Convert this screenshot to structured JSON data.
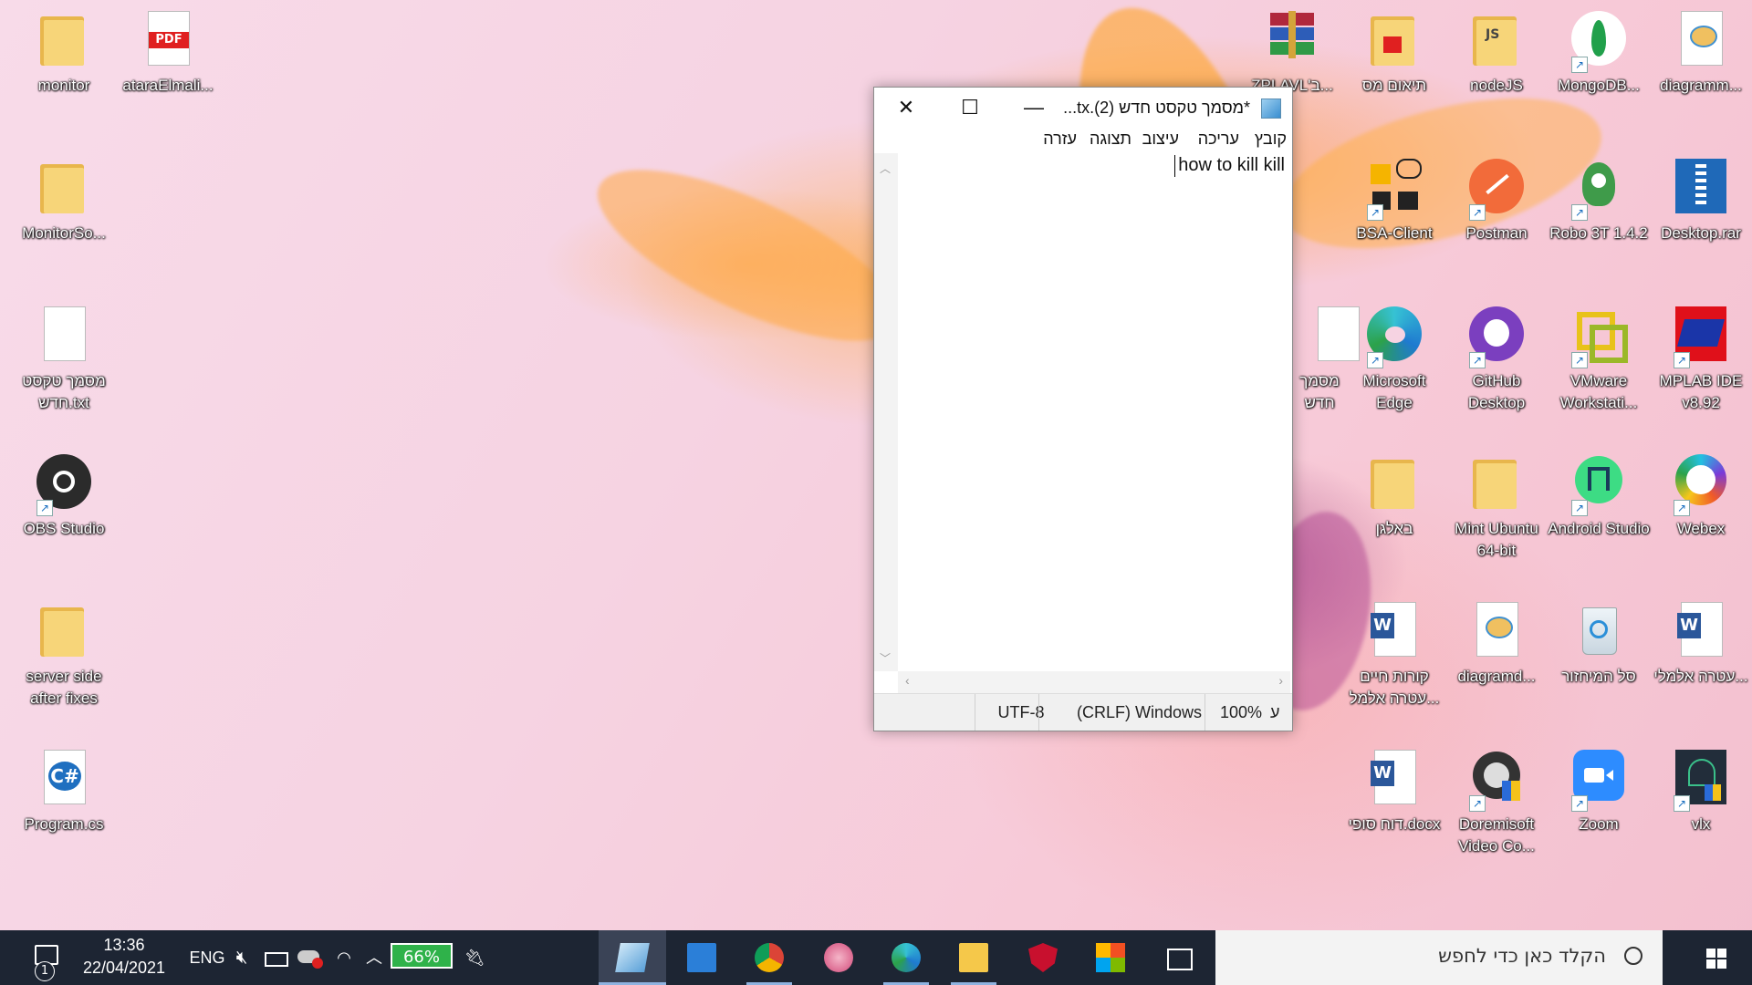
{
  "desktop": {
    "left_icons": [
      {
        "label": "monitor"
      },
      {
        "label": "ataraElmali..."
      },
      {
        "label": "MonitorSo..."
      },
      {
        "label": "מסמך טקסט חדש.txt"
      },
      {
        "label": "OBS Studio"
      },
      {
        "label": "server side after fixes"
      },
      {
        "label": "Program.cs"
      }
    ],
    "right_icons": [
      {
        "label": "ZPLAVL'ב..."
      },
      {
        "label": "תיאום מס"
      },
      {
        "label": "nodeJS"
      },
      {
        "label": "MongoDB..."
      },
      {
        "label": "diagramm..."
      },
      {
        "label": "BSA-Client"
      },
      {
        "label": "Postman"
      },
      {
        "label": "Robo 3T 1.4.2"
      },
      {
        "label": "Desktop.rar"
      },
      {
        "label": "מסמך חדש"
      },
      {
        "label": "Microsoft Edge"
      },
      {
        "label": "GitHub Desktop"
      },
      {
        "label": "VMware Workstati..."
      },
      {
        "label": "MPLAB IDE v8.92"
      },
      {
        "label": "באלגן"
      },
      {
        "label": "Mint Ubuntu 64-bit"
      },
      {
        "label": "Android Studio"
      },
      {
        "label": "Webex"
      },
      {
        "label": "קורות חיים עטרה אלמל..."
      },
      {
        "label": "diagramd..."
      },
      {
        "label": "סל המיחזור"
      },
      {
        "label": "עטרה אלמלי..."
      },
      {
        "label": "דוח סופי.docx"
      },
      {
        "label": "Doremisoft Video Co..."
      },
      {
        "label": "Zoom"
      },
      {
        "label": "vlx"
      }
    ]
  },
  "notepad": {
    "title": "*מסמך טקסט חדש (2).tx...",
    "menu": [
      "קובץ",
      "עריכה",
      "עיצוב",
      "תצוגה",
      "עזרה"
    ],
    "content": "how to kill kill",
    "status": {
      "encoding": "UTF-8",
      "line_ending": "(CRLF) Windows",
      "zoom": "100%",
      "position": "ע"
    }
  },
  "taskbar": {
    "search_placeholder": "הקלד כאן כדי לחפש",
    "time": "13:36",
    "date": "22/04/2021",
    "language": "ENG",
    "battery": "66%",
    "notification_count": "1"
  },
  "colors": {
    "taskbar_bg": "#1d2533",
    "battery_green": "#2fb24a"
  }
}
